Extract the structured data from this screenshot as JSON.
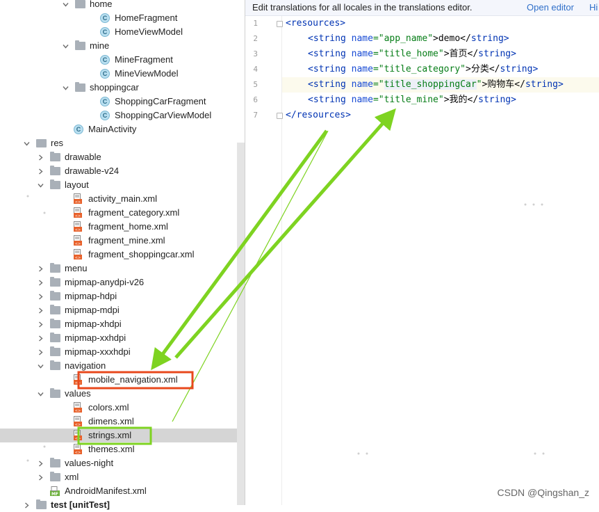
{
  "project_tree": {
    "rows": [
      {
        "label": "home",
        "kind": "folder-pkg",
        "arrow": "down",
        "indent": 124
      },
      {
        "label": "HomeFragment",
        "kind": "class",
        "indent": 160
      },
      {
        "label": "HomeViewModel",
        "kind": "class",
        "indent": 160
      },
      {
        "label": "mine",
        "kind": "folder-pkg",
        "arrow": "down",
        "indent": 124
      },
      {
        "label": "MineFragment",
        "kind": "class",
        "indent": 160
      },
      {
        "label": "MineViewModel",
        "kind": "class",
        "indent": 160
      },
      {
        "label": "shoppingcar",
        "kind": "folder-pkg",
        "arrow": "down",
        "indent": 124
      },
      {
        "label": "ShoppingCarFragment",
        "kind": "class",
        "indent": 160
      },
      {
        "label": "ShoppingCarViewModel",
        "kind": "class",
        "indent": 160
      },
      {
        "label": "MainActivity",
        "kind": "class",
        "indent": 122
      },
      {
        "label": "res",
        "kind": "res",
        "arrow": "down",
        "indent": 68
      },
      {
        "label": "drawable",
        "kind": "folder",
        "arrow": "right",
        "indent": 88
      },
      {
        "label": "drawable-v24",
        "kind": "folder",
        "arrow": "right",
        "indent": 88
      },
      {
        "label": "layout",
        "kind": "folder",
        "arrow": "down",
        "indent": 88
      },
      {
        "label": "activity_main.xml",
        "kind": "xml",
        "indent": 122
      },
      {
        "label": "fragment_category.xml",
        "kind": "xml",
        "indent": 122
      },
      {
        "label": "fragment_home.xml",
        "kind": "xml",
        "indent": 122
      },
      {
        "label": "fragment_mine.xml",
        "kind": "xml",
        "indent": 122
      },
      {
        "label": "fragment_shoppingcar.xml",
        "kind": "xml",
        "indent": 122
      },
      {
        "label": "menu",
        "kind": "folder",
        "arrow": "right",
        "indent": 88
      },
      {
        "label": "mipmap-anydpi-v26",
        "kind": "folder",
        "arrow": "right",
        "indent": 88
      },
      {
        "label": "mipmap-hdpi",
        "kind": "folder",
        "arrow": "right",
        "indent": 88
      },
      {
        "label": "mipmap-mdpi",
        "kind": "folder",
        "arrow": "right",
        "indent": 88
      },
      {
        "label": "mipmap-xhdpi",
        "kind": "folder",
        "arrow": "right",
        "indent": 88
      },
      {
        "label": "mipmap-xxhdpi",
        "kind": "folder",
        "arrow": "right",
        "indent": 88
      },
      {
        "label": "mipmap-xxxhdpi",
        "kind": "folder",
        "arrow": "right",
        "indent": 88
      },
      {
        "label": "navigation",
        "kind": "folder",
        "arrow": "down",
        "indent": 88
      },
      {
        "label": "mobile_navigation.xml",
        "kind": "xml",
        "indent": 122,
        "boxed": "#e8491d"
      },
      {
        "label": "values",
        "kind": "folder",
        "arrow": "down",
        "indent": 88
      },
      {
        "label": "colors.xml",
        "kind": "xml",
        "indent": 122
      },
      {
        "label": "dimens.xml",
        "kind": "xml",
        "indent": 122
      },
      {
        "label": "strings.xml",
        "kind": "xml",
        "indent": 122,
        "boxed": "#7ed321",
        "selected": true
      },
      {
        "label": "themes.xml",
        "kind": "xml",
        "indent": 122
      },
      {
        "label": "values-night",
        "kind": "folder",
        "arrow": "right",
        "indent": 88
      },
      {
        "label": "xml",
        "kind": "folder",
        "arrow": "right",
        "indent": 88
      },
      {
        "label": "AndroidManifest.xml",
        "kind": "manifest",
        "indent": 88
      },
      {
        "label": "test [unitTest]",
        "kind": "folder",
        "arrow": "right",
        "indent": 68,
        "bold": true
      }
    ]
  },
  "editor": {
    "banner": {
      "message": "Edit translations for all locales in the translations editor.",
      "open_editor": "Open editor",
      "hide": "Hi"
    },
    "line_numbers": [
      "1",
      "2",
      "3",
      "4",
      "5",
      "6",
      "7"
    ],
    "lines": [
      {
        "indent": 0,
        "parts": [
          {
            "t": "<",
            "c": "tg"
          },
          {
            "t": "resources",
            "c": "tg"
          },
          {
            "t": ">",
            "c": "tg"
          }
        ]
      },
      {
        "indent": 1,
        "parts": [
          {
            "t": "<string ",
            "c": "tg"
          },
          {
            "t": "name",
            "c": "at"
          },
          {
            "t": "=\"app_name\"",
            "c": "av"
          },
          {
            "t": ">demo</",
            "c": ""
          },
          {
            "t": "string",
            "c": "tg"
          },
          {
            "t": ">",
            "c": "tg"
          }
        ]
      },
      {
        "indent": 1,
        "parts": [
          {
            "t": "<string ",
            "c": "tg"
          },
          {
            "t": "name",
            "c": "at"
          },
          {
            "t": "=\"title_home\"",
            "c": "av"
          },
          {
            "t": ">首页</",
            "c": ""
          },
          {
            "t": "string",
            "c": "tg"
          },
          {
            "t": ">",
            "c": "tg"
          }
        ]
      },
      {
        "indent": 1,
        "parts": [
          {
            "t": "<string ",
            "c": "tg"
          },
          {
            "t": "name",
            "c": "at"
          },
          {
            "t": "=\"title_category\"",
            "c": "av"
          },
          {
            "t": ">分类</",
            "c": ""
          },
          {
            "t": "string",
            "c": "tg"
          },
          {
            "t": ">",
            "c": "tg"
          }
        ]
      },
      {
        "indent": 1,
        "parts": [
          {
            "t": "<string ",
            "c": "tg"
          },
          {
            "t": "name",
            "c": "at"
          },
          {
            "t": "=\"",
            "c": "av"
          },
          {
            "t": "title_shoppingCar",
            "c": "av hl"
          },
          {
            "t": "\"",
            "c": "av"
          },
          {
            "t": ">购物车</",
            "c": ""
          },
          {
            "t": "string",
            "c": "tg"
          },
          {
            "t": ">",
            "c": "tg"
          }
        ],
        "current": true
      },
      {
        "indent": 1,
        "parts": [
          {
            "t": "<string ",
            "c": "tg"
          },
          {
            "t": "name",
            "c": "at"
          },
          {
            "t": "=\"title_mine\"",
            "c": "av"
          },
          {
            "t": ">我的</",
            "c": ""
          },
          {
            "t": "string",
            "c": "tg"
          },
          {
            "t": ">",
            "c": "tg"
          }
        ]
      },
      {
        "indent": 0,
        "parts": [
          {
            "t": "</",
            "c": "tg"
          },
          {
            "t": "resources",
            "c": "tg"
          },
          {
            "t": ">",
            "c": "tg"
          }
        ]
      }
    ]
  },
  "watermark": "CSDN @Qingshan_z",
  "colors": {
    "arrow_green": "#7ed321",
    "box_orange": "#e8491d"
  }
}
